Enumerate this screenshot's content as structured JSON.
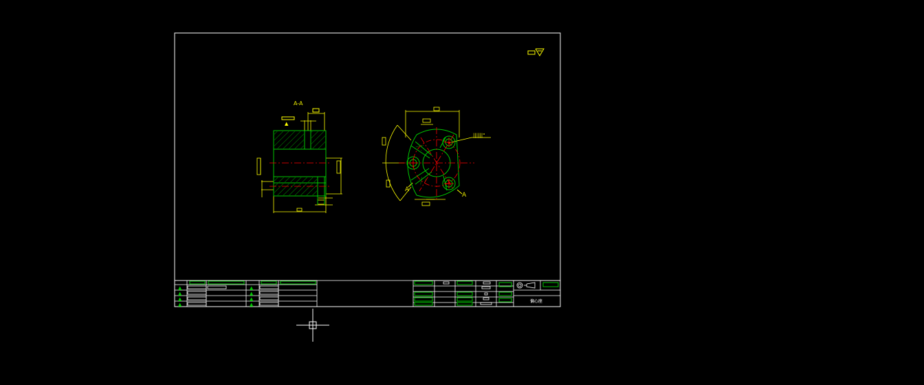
{
  "app": {
    "view": "model-space",
    "background": "#000000"
  },
  "colors": {
    "frame": "#ffffff",
    "part": "#00c800",
    "dimension": "#e6e600",
    "centerline": "#ff0000",
    "cursor": "#ffffff"
  },
  "drawing": {
    "section_label": "A-A",
    "cut_label_right": "A",
    "cut_label_left": "A"
  },
  "title_block": {
    "part_name": "偏心座"
  },
  "cursor": {
    "icon": "crosshair-pickbox-icon"
  }
}
